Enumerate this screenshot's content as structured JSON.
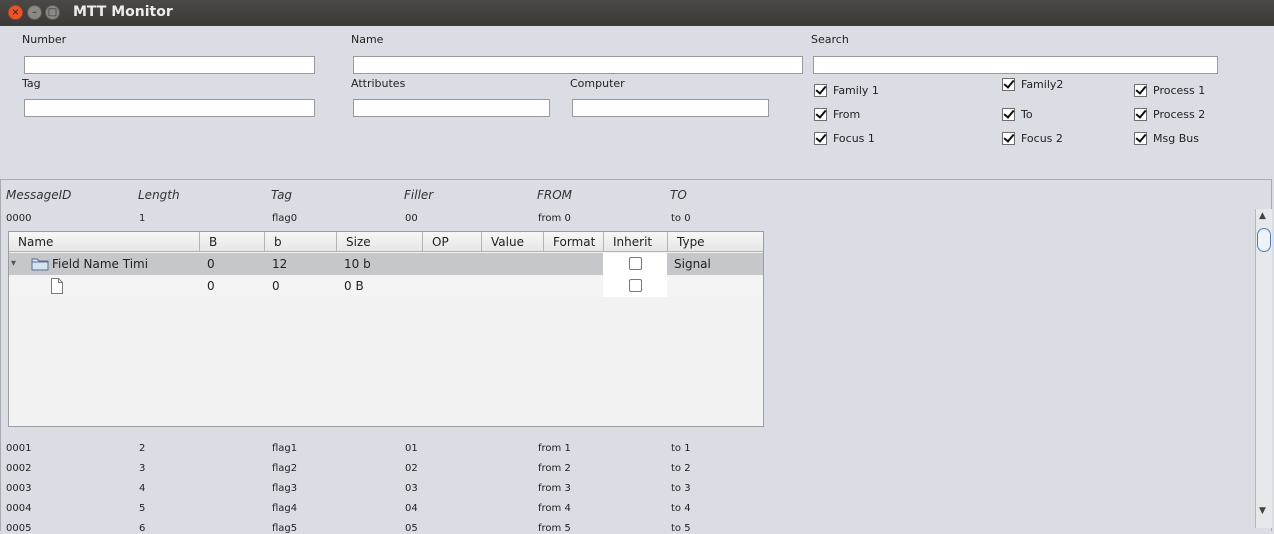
{
  "window": {
    "title": "MTT Monitor",
    "close_glyph": "×",
    "min_glyph": "–",
    "max_glyph": "□"
  },
  "filters": {
    "number_label": "Number",
    "number_value": "",
    "name_label": "Name",
    "name_value": "",
    "search_label": "Search",
    "search_value": "",
    "tag_label": "Tag",
    "tag_value": "",
    "attributes_label": "Attributes",
    "attributes_value": "",
    "computer_label": "Computer",
    "computer_value": ""
  },
  "checkboxes": [
    {
      "label": "Family 1",
      "checked": true
    },
    {
      "label": "Family2",
      "checked": true
    },
    {
      "label": "Process 1",
      "checked": true
    },
    {
      "label": "From",
      "checked": true
    },
    {
      "label": "To",
      "checked": true
    },
    {
      "label": "Process 2",
      "checked": true
    },
    {
      "label": "Focus 1",
      "checked": true
    },
    {
      "label": "Focus 2",
      "checked": true
    },
    {
      "label": "Msg Bus",
      "checked": true
    }
  ],
  "messages": {
    "headers": [
      "MessageID",
      "Length",
      "Tag",
      "Filler",
      "FROM",
      "TO"
    ],
    "rows": [
      [
        "0000",
        "1",
        "flag0",
        "00",
        "from 0",
        "to 0"
      ],
      [
        "0001",
        "2",
        "flag1",
        "01",
        "from 1",
        "to 1"
      ],
      [
        "0002",
        "3",
        "flag2",
        "02",
        "from 2",
        "to 2"
      ],
      [
        "0003",
        "4",
        "flag3",
        "03",
        "from 3",
        "to 3"
      ],
      [
        "0004",
        "5",
        "flag4",
        "04",
        "from 4",
        "to 4"
      ],
      [
        "0005",
        "6",
        "flag5",
        "05",
        "from 5",
        "to 5"
      ]
    ]
  },
  "tree": {
    "headers": [
      "Name",
      "B",
      "b",
      "Size",
      "OP",
      "Value",
      "Format",
      "Inherit",
      "Type"
    ],
    "rows": [
      {
        "expander": "▾",
        "name": "Field Name Timi",
        "B": "0",
        "b": "12",
        "size": "10 b",
        "op": "",
        "value": "",
        "format": "",
        "inherit": false,
        "type": "Signal",
        "icon": "folder-icon"
      },
      {
        "expander": "",
        "name": "",
        "B": "0",
        "b": "0",
        "size": "0 B",
        "op": "",
        "value": "",
        "format": "",
        "inherit": false,
        "type": "",
        "icon": "file-icon"
      }
    ]
  },
  "scrollbar": {
    "up_glyph": "▲",
    "down_glyph": "▼"
  }
}
